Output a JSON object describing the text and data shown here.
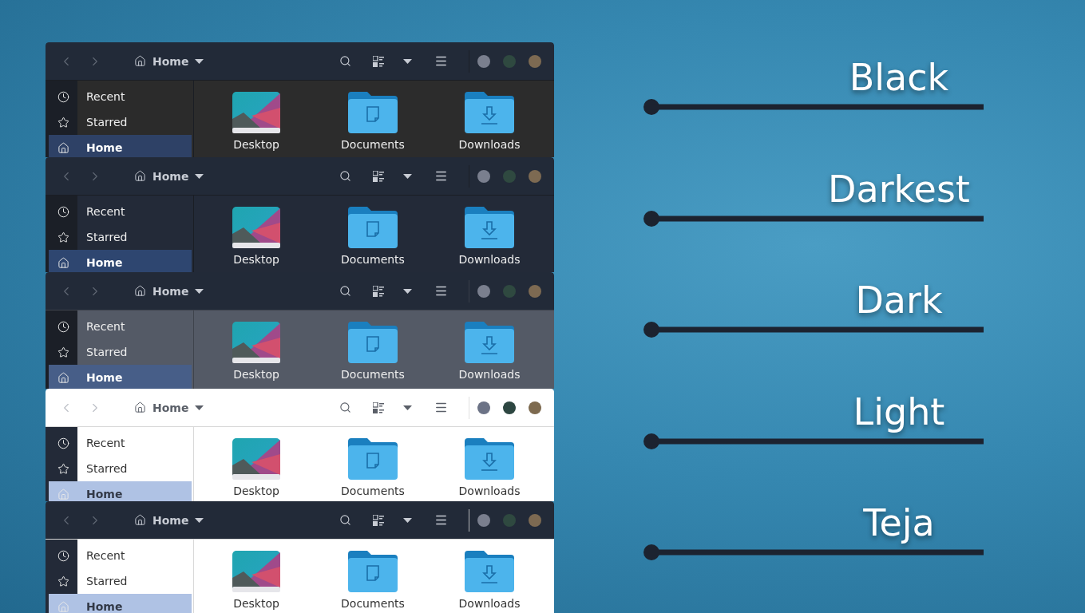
{
  "windows": [
    {
      "kind": "black",
      "location": "Home",
      "sidebar": [
        {
          "label": "Recent",
          "selected": false
        },
        {
          "label": "Starred",
          "selected": false
        },
        {
          "label": "Home",
          "selected": true
        }
      ],
      "files": [
        {
          "kind": "desktop",
          "label": "Desktop"
        },
        {
          "kind": "documents",
          "label": "Documents"
        },
        {
          "kind": "downloads",
          "label": "Downloads"
        }
      ],
      "dots": [
        {
          "color": "#7a7f8e"
        },
        {
          "color": "#2f4940"
        },
        {
          "color": "#7d6a52"
        }
      ]
    },
    {
      "kind": "darkest",
      "location": "Home",
      "sidebar": [
        {
          "label": "Recent",
          "selected": false
        },
        {
          "label": "Starred",
          "selected": false
        },
        {
          "label": "Home",
          "selected": true
        }
      ],
      "files": [
        {
          "kind": "desktop",
          "label": "Desktop"
        },
        {
          "kind": "documents",
          "label": "Documents"
        },
        {
          "kind": "downloads",
          "label": "Downloads"
        }
      ],
      "dots": [
        {
          "color": "#7a7f8e"
        },
        {
          "color": "#2f4940"
        },
        {
          "color": "#7d6a52"
        }
      ]
    },
    {
      "kind": "dark",
      "location": "Home",
      "sidebar": [
        {
          "label": "Recent",
          "selected": false
        },
        {
          "label": "Starred",
          "selected": false
        },
        {
          "label": "Home",
          "selected": true
        }
      ],
      "files": [
        {
          "kind": "desktop",
          "label": "Desktop"
        },
        {
          "kind": "documents",
          "label": "Documents"
        },
        {
          "kind": "downloads",
          "label": "Downloads"
        }
      ],
      "dots": [
        {
          "color": "#7a7f8e"
        },
        {
          "color": "#2f4940"
        },
        {
          "color": "#7d6a52"
        }
      ]
    },
    {
      "kind": "light",
      "location": "Home",
      "sidebar": [
        {
          "label": "Recent",
          "selected": false
        },
        {
          "label": "Starred",
          "selected": false
        },
        {
          "label": "Home",
          "selected": true
        }
      ],
      "files": [
        {
          "kind": "desktop",
          "label": "Desktop"
        },
        {
          "kind": "documents",
          "label": "Documents"
        },
        {
          "kind": "downloads",
          "label": "Downloads"
        }
      ],
      "dots": [
        {
          "color": "#6c7386"
        },
        {
          "color": "#2d4641"
        },
        {
          "color": "#7d6a4f"
        }
      ]
    },
    {
      "kind": "teja",
      "location": "Home",
      "sidebar": [
        {
          "label": "Recent",
          "selected": false
        },
        {
          "label": "Starred",
          "selected": false
        },
        {
          "label": "Home",
          "selected": true
        }
      ],
      "files": [
        {
          "kind": "desktop",
          "label": "Desktop"
        },
        {
          "kind": "documents",
          "label": "Documents"
        },
        {
          "kind": "downloads",
          "label": "Downloads"
        }
      ],
      "dots": [
        {
          "color": "#7a7f8e"
        },
        {
          "color": "#2f4940"
        },
        {
          "color": "#7d6a52"
        }
      ]
    }
  ],
  "variant_labels": [
    "Black",
    "Darkest",
    "Dark",
    "Light",
    "Teja"
  ]
}
